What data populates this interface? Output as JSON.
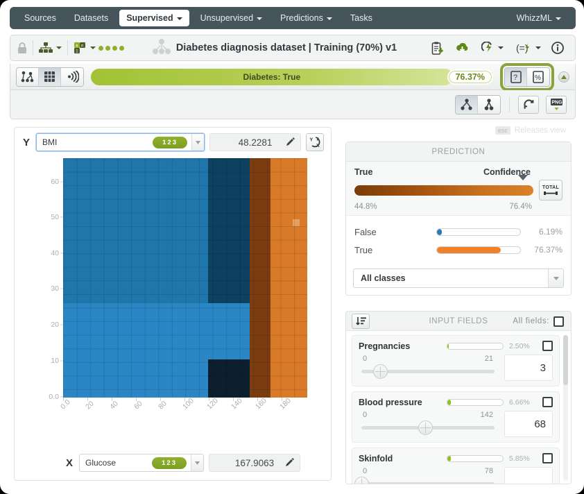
{
  "nav": {
    "items": [
      {
        "label": "Sources",
        "has_caret": false,
        "active": false
      },
      {
        "label": "Datasets",
        "has_caret": false,
        "active": false
      },
      {
        "label": "Supervised",
        "has_caret": true,
        "active": true
      },
      {
        "label": "Unsupervised",
        "has_caret": true,
        "active": false
      },
      {
        "label": "Predictions",
        "has_caret": true,
        "active": false
      },
      {
        "label": "Tasks",
        "has_caret": false,
        "active": false
      }
    ],
    "right_label": "WhizzML"
  },
  "resource_bar": {
    "title": "Diabetes diagnosis dataset | Training (70%) v1",
    "lock_icon": "lock-icon",
    "model_icon": "model-tree-icon",
    "fields_icon": "fields-icon",
    "status_dots": 4,
    "actions": [
      "clipboard-download-icon",
      "cloud-download-icon",
      "flash-icon",
      "equation-flash-icon",
      "info-icon"
    ]
  },
  "prediction_bar": {
    "view_buttons": [
      {
        "name": "tree-view-icon",
        "active": false
      },
      {
        "name": "grid-view-icon",
        "active": true
      },
      {
        "name": "sunburst-view-icon",
        "active": false
      }
    ],
    "objective_label": "Diabetes: True",
    "objective_pct": "76.37%",
    "right_buttons": [
      {
        "name": "question-brace-icon",
        "active": true
      },
      {
        "name": "percent-brace-icon",
        "active": false
      }
    ],
    "collapse_icon": "collapse-up-icon"
  },
  "sub_bar": {
    "buttons": [
      {
        "name": "model-expanded-icon",
        "active": true
      },
      {
        "name": "model-compact-icon",
        "active": false
      },
      {
        "name": "refresh-icon",
        "active": false
      },
      {
        "name": "png-download-icon",
        "active": false
      }
    ]
  },
  "esc_hint": {
    "badge": "esc",
    "text": "Releases view"
  },
  "chart_panel": {
    "y": {
      "axis_letter": "Y",
      "field": "BMI",
      "type_badge": "123",
      "value": "48.2281",
      "pencil_icon": "pencil-icon",
      "swap_icon": "swap-axes-icon"
    },
    "x": {
      "axis_letter": "X",
      "field": "Glucose",
      "type_badge": "123",
      "value": "167.9063",
      "pencil_icon": "pencil-icon"
    }
  },
  "chart_data": {
    "type": "heatmap",
    "title": "",
    "xlabel": "Glucose",
    "ylabel": "BMI",
    "xlim": [
      0,
      199
    ],
    "ylim": [
      0,
      67.1
    ],
    "grid": true,
    "x_ticks": [
      "0.0",
      "20",
      "40",
      "60",
      "80",
      "100",
      "120",
      "140",
      "160",
      "180"
    ],
    "y_ticks": [
      "0.0",
      "10",
      "20",
      "30",
      "40",
      "50",
      "60"
    ],
    "legend": "none",
    "colors": {
      "false_medium": "#1f76ab",
      "false_light": "#2a86c4",
      "false_dark": "#0e4060",
      "false_darkest": "#0b1f2e",
      "true_dark": "#7b3d10",
      "true_light": "#d97a28",
      "highlight_cell": "#e5a064"
    },
    "regions": [
      {
        "class": "False",
        "x0": 0,
        "x1": 118,
        "y0": 26.5,
        "y1": 67.1,
        "color": "#1f76ab",
        "note": "medium blue upper-left"
      },
      {
        "class": "False",
        "x0": 0,
        "x1": 118,
        "y0": 0,
        "y1": 26.5,
        "color": "#2a86c4",
        "note": "light blue lower-left"
      },
      {
        "class": "False",
        "x0": 118,
        "x1": 152,
        "y0": 26.5,
        "y1": 67.1,
        "color": "#0e4060",
        "note": "dark blue upper middle"
      },
      {
        "class": "False",
        "x0": 118,
        "x1": 152,
        "y0": 0,
        "y1": 26.5,
        "color": "#2a86c4",
        "note": "light blue strip"
      },
      {
        "class": "False",
        "x0": 118,
        "x1": 152,
        "y0": 0,
        "y1": 10.5,
        "color": "#0b1f2e",
        "note": "darkest blue lower block"
      },
      {
        "class": "True",
        "x0": 152,
        "x1": 168,
        "y0": 0,
        "y1": 67.1,
        "color": "#7b3d10",
        "note": "dark orange band"
      },
      {
        "class": "True",
        "x0": 168,
        "x1": 199,
        "y0": 0,
        "y1": 67.1,
        "color": "#d97a28",
        "note": "bright orange right"
      }
    ],
    "highlight_point": {
      "x": 167.9063,
      "y": 48.2281,
      "color": "#e5a064"
    }
  },
  "prediction": {
    "header": "PREDICTION",
    "class_label": "True",
    "confidence_label": "Confidence",
    "confidence_min": "44.8%",
    "confidence_max": "76.4%",
    "total_button": "TOTAL",
    "classes": [
      {
        "name": "False",
        "pct_label": "6.19%",
        "pct": 6.19,
        "color": "#2a7ab5"
      },
      {
        "name": "True",
        "pct_label": "76.37%",
        "pct": 76.37,
        "color": "#ef8128"
      }
    ],
    "class_filter": "All classes"
  },
  "input_fields": {
    "header": "INPUT FIELDS",
    "sort_icon": "sort-descending-icon",
    "all_fields_label": "All fields:",
    "all_fields_checked": false,
    "fields": [
      {
        "name": "Pregnancies",
        "importance_label": "2.50%",
        "importance": 2.5,
        "min": "0",
        "max": "21",
        "value": "3",
        "slider_pct": 14,
        "checked": false
      },
      {
        "name": "Blood pressure",
        "importance_label": "6.66%",
        "importance": 6.66,
        "min": "0",
        "max": "142",
        "value": "68",
        "slider_pct": 48,
        "checked": false
      },
      {
        "name": "Skinfold",
        "importance_label": "5.85%",
        "importance": 5.85,
        "min": "0",
        "max": "78",
        "value": "",
        "slider_pct": 0,
        "checked": false
      }
    ]
  }
}
